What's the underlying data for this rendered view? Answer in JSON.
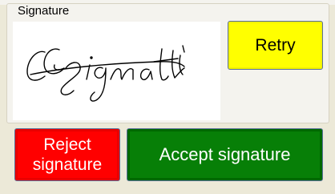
{
  "signature_panel": {
    "group_label": "Signature"
  },
  "buttons": {
    "retry_label": "Retry",
    "reject_label": "Reject\nsignature",
    "accept_label": "Accept signature"
  },
  "colors": {
    "retry_bg": "#ffff00",
    "reject_bg": "#ff0000",
    "accept_bg": "#077f07"
  }
}
